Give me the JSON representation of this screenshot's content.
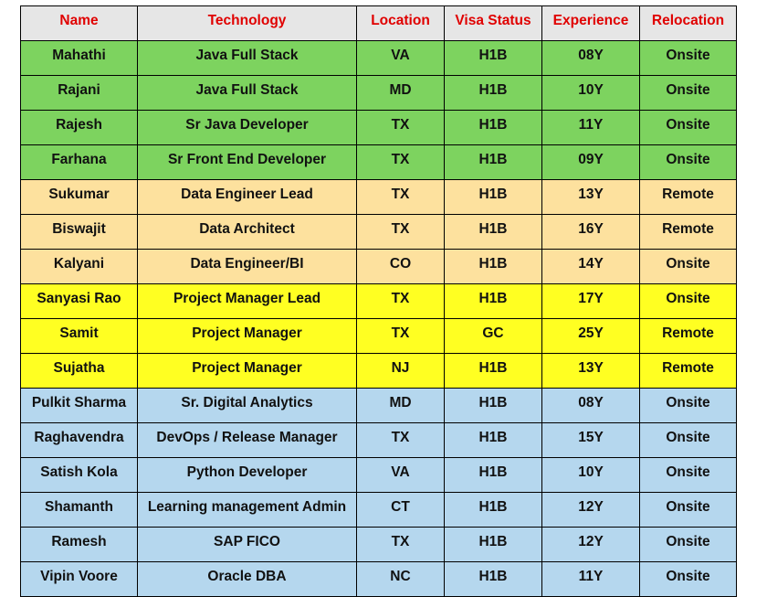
{
  "colors": {
    "header_bg": "#e6e6e6",
    "header_text": "#e00000",
    "green": "#7dd35f",
    "tan": "#fde19e",
    "yellow": "#ffff22",
    "blue": "#b5d7ee"
  },
  "table": {
    "headers": [
      "Name",
      "Technology",
      "Location",
      "Visa Status",
      "Experience",
      "Relocation"
    ],
    "rows": [
      {
        "group": "green",
        "cells": [
          "Mahathi",
          "Java Full Stack",
          "VA",
          "H1B",
          "08Y",
          "Onsite"
        ]
      },
      {
        "group": "green",
        "cells": [
          "Rajani",
          "Java Full Stack",
          "MD",
          "H1B",
          "10Y",
          "Onsite"
        ]
      },
      {
        "group": "green",
        "cells": [
          "Rajesh",
          "Sr Java Developer",
          "TX",
          "H1B",
          "11Y",
          "Onsite"
        ]
      },
      {
        "group": "green",
        "cells": [
          "Farhana",
          "Sr Front End Developer",
          "TX",
          "H1B",
          "09Y",
          "Onsite"
        ]
      },
      {
        "group": "tan",
        "cells": [
          "Sukumar",
          "Data Engineer Lead",
          "TX",
          "H1B",
          "13Y",
          "Remote"
        ]
      },
      {
        "group": "tan",
        "cells": [
          "Biswajit",
          "Data Architect",
          "TX",
          "H1B",
          "16Y",
          "Remote"
        ]
      },
      {
        "group": "tan",
        "cells": [
          "Kalyani",
          "Data Engineer/BI",
          "CO",
          "H1B",
          "14Y",
          "Onsite"
        ]
      },
      {
        "group": "yellow",
        "cells": [
          "Sanyasi Rao",
          "Project Manager Lead",
          "TX",
          "H1B",
          "17Y",
          "Onsite"
        ]
      },
      {
        "group": "yellow",
        "cells": [
          "Samit",
          "Project Manager",
          "TX",
          "GC",
          "25Y",
          "Remote"
        ]
      },
      {
        "group": "yellow",
        "cells": [
          "Sujatha",
          "Project Manager",
          "NJ",
          "H1B",
          "13Y",
          "Remote"
        ]
      },
      {
        "group": "blue",
        "cells": [
          "Pulkit Sharma",
          "Sr. Digital Analytics",
          "MD",
          "H1B",
          "08Y",
          "Onsite"
        ]
      },
      {
        "group": "blue",
        "cells": [
          "Raghavendra",
          "DevOps / Release Manager",
          "TX",
          "H1B",
          "15Y",
          "Onsite"
        ]
      },
      {
        "group": "blue",
        "cells": [
          "Satish Kola",
          "Python Developer",
          "VA",
          "H1B",
          "10Y",
          "Onsite"
        ]
      },
      {
        "group": "blue",
        "cells": [
          "Shamanth",
          "Learning management Admin",
          "CT",
          "H1B",
          "12Y",
          "Onsite"
        ]
      },
      {
        "group": "blue",
        "cells": [
          "Ramesh",
          "SAP FICO",
          "TX",
          "H1B",
          "12Y",
          "Onsite"
        ]
      },
      {
        "group": "blue",
        "cells": [
          "Vipin Voore",
          "Oracle DBA",
          "NC",
          "H1B",
          "11Y",
          "Onsite"
        ]
      }
    ]
  }
}
